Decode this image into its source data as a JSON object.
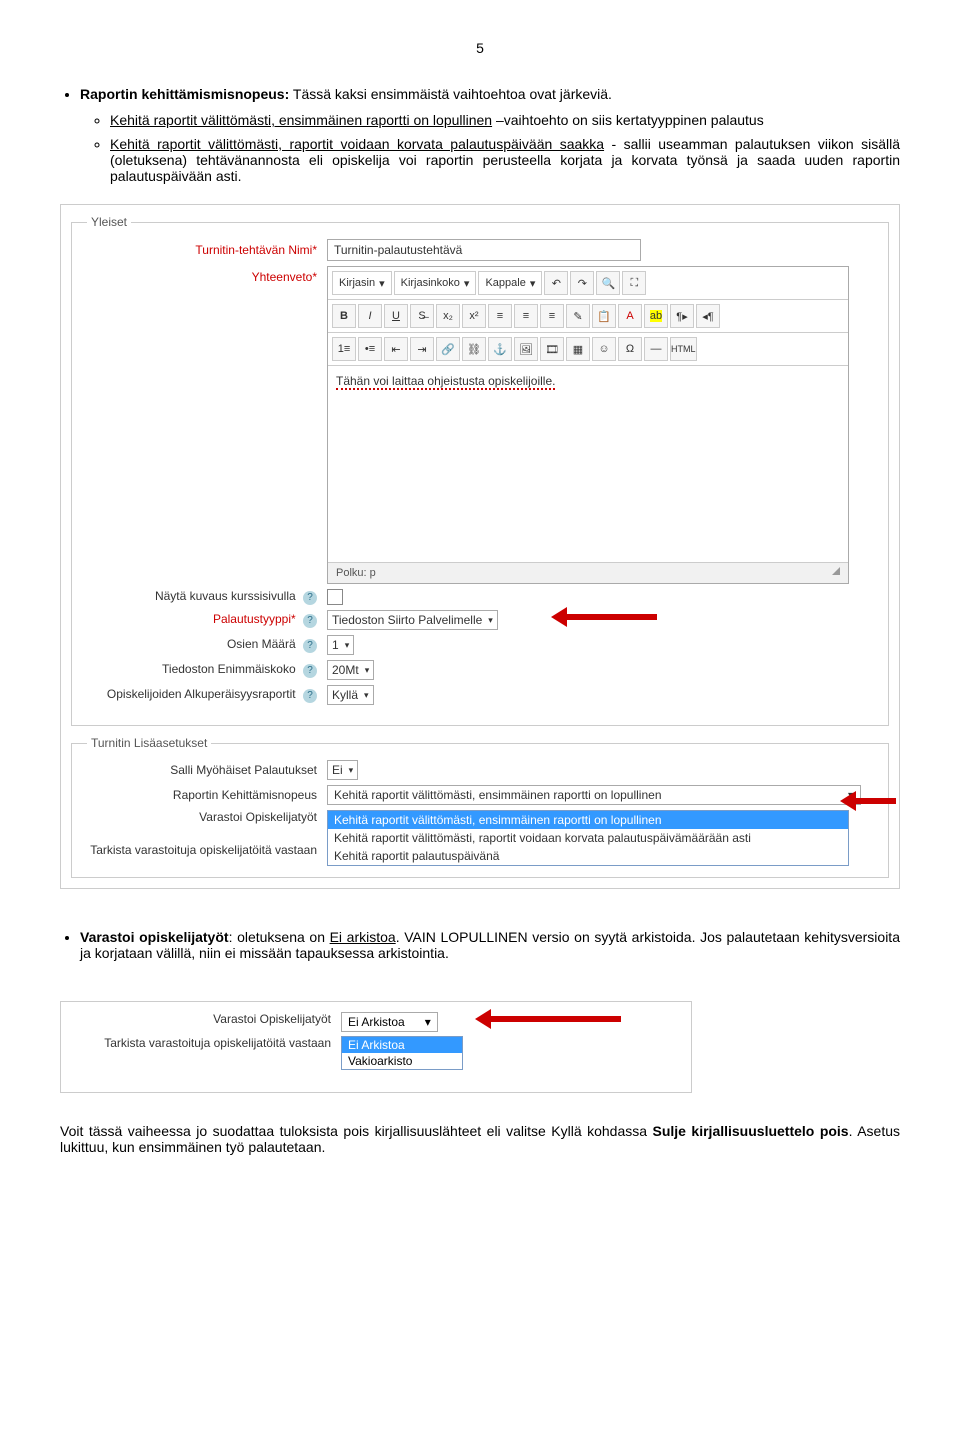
{
  "page_number": "5",
  "bullet1": {
    "title": "Raportin kehittämismisnopeus:",
    "text": " Tässä kaksi ensimmäistä vaihtoehtoa ovat järkeviä.",
    "sub1_link": "Kehitä raportit välittömästi, ensimmäinen raportti on lopullinen",
    "sub1_rest": " –vaihtoehto on siis kertatyyppinen palautus",
    "sub2_link": "Kehitä raportit välittömästi, raportit voidaan korvata palautuspäivään saakka",
    "sub2_rest": " - sallii useamman palautuksen viikon sisällä (oletuksena) tehtävänannosta eli opiskelija voi raportin perusteella korjata ja korvata työnsä ja saada uuden raportin palautuspäivään asti."
  },
  "form": {
    "fieldset1_legend": "Yleiset",
    "nimi_label": "Turnitin-tehtävän Nimi",
    "nimi_value": "Turnitin-palautustehtävä",
    "yhteenveto_label": "Yhteenveto",
    "tb_font": "Kirjasin",
    "tb_size": "Kirjasinkoko",
    "tb_format": "Kappale",
    "editor_text": "Tähän voi laittaa ohjeistusta opiskelijoille.",
    "path": "Polku: p",
    "row_kuvaus": "Näytä kuvaus kurssisivulla",
    "row_palautustyyppi": "Palautustyyppi",
    "palautustyyppi_value": "Tiedoston Siirto Palvelimelle",
    "row_osien": "Osien Määrä",
    "osien_value": "1",
    "row_tiedoston": "Tiedoston Enimmäiskoko",
    "tiedoston_value": "20Mt",
    "row_alkup": "Opiskelijoiden Alkuperäisyysraportit",
    "alkup_value": "Kyllä",
    "fieldset2_legend": "Turnitin Lisäasetukset",
    "row_salli": "Salli Myöhäiset Palautukset",
    "salli_value": "Ei",
    "row_kehitys": "Raportin Kehittämisnopeus",
    "row_varastoi": "Varastoi Opiskelijatyöt",
    "row_tarkista": "Tarkista varastoituja opiskelijatöitä vastaan",
    "dd_selected": "Kehitä raportit välittömästi, ensimmäinen raportti on lopullinen",
    "dd_opt1": "Kehitä raportit välittömästi, ensimmäinen raportti on lopullinen",
    "dd_opt2": "Kehitä raportit välittömästi, raportit voidaan korvata palautuspäivämäärään asti",
    "dd_opt3": "Kehitä raportit palautuspäivänä"
  },
  "bullet2": {
    "title": "Varastoi opiskelijatyöt",
    "rest1": ": oletuksena on ",
    "under": "Ei arkistoa",
    "rest2": ". VAIN LOPULLINEN versio on syytä arkistoida. Jos palautetaan kehitysversioita ja korjataan välillä, niin ei missään tapauksessa arkistointia."
  },
  "s2": {
    "row_varastoi": "Varastoi Opiskelijatyöt",
    "varastoi_value": "Ei Arkistoa",
    "dd_opt1": "Ei Arkistoa",
    "dd_opt2": "Vakioarkisto",
    "row_tarkista": "Tarkista varastoituja opiskelijatöitä vastaan"
  },
  "footer1": "Voit tässä vaiheessa jo suodattaa tuloksista pois kirjallisuuslähteet eli valitse Kyllä kohdassa ",
  "footer_bold": "Sulje kirjallisuusluettelo pois",
  "footer2": ". Asetus lukittuu, kun ensimmäinen työ palautetaan."
}
